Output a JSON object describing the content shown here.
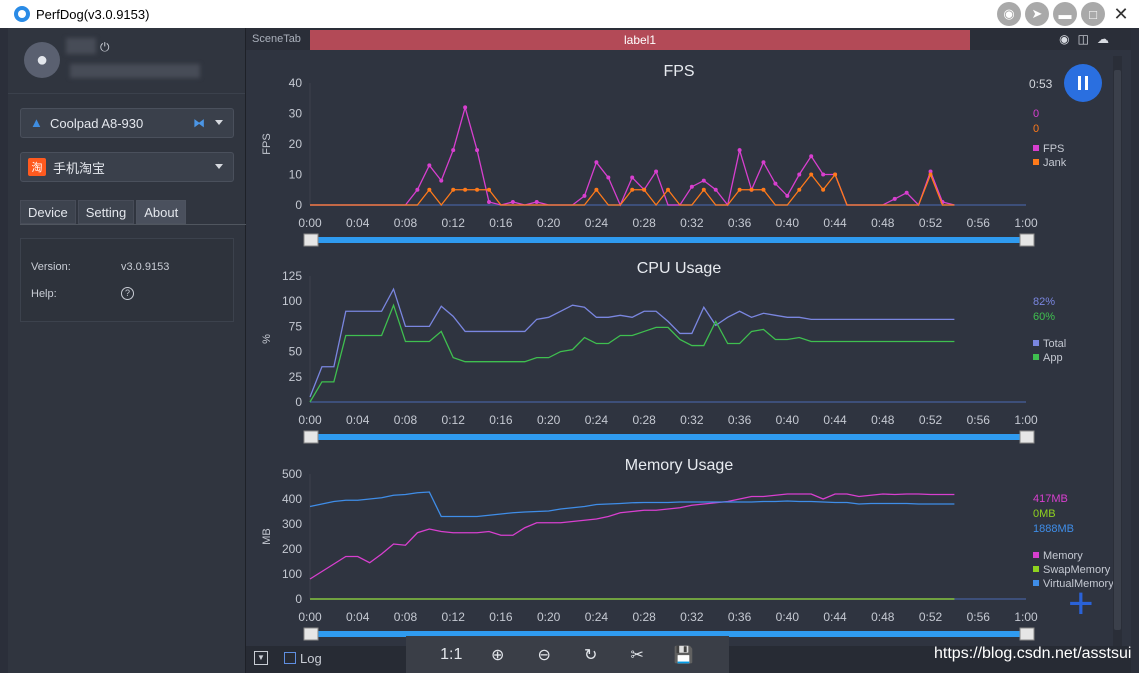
{
  "window": {
    "title": "PerfDog(v3.0.9153)"
  },
  "sidebar": {
    "device": "Coolpad A8-930",
    "app": "手机淘宝",
    "app_icon_text": "淘",
    "tabs": [
      "Device",
      "Setting",
      "About"
    ],
    "about": {
      "version_label": "Version:",
      "version_value": "v3.0.9153",
      "help_label": "Help:"
    }
  },
  "main": {
    "scene_tab": "SceneTab",
    "scene_label": "label1",
    "elapsed": "0:53"
  },
  "bottom": {
    "log_label": "Log",
    "watermark": "https://blog.csdn.net/asstsui"
  },
  "chart_data": [
    {
      "type": "line",
      "title": "FPS",
      "ylabel": "FPS",
      "xlabel": "",
      "ylim": [
        0,
        40
      ],
      "yticks": [
        0,
        10,
        20,
        30,
        40
      ],
      "x_ticks": [
        "0:00",
        "0:04",
        "0:08",
        "0:12",
        "0:16",
        "0:20",
        "0:24",
        "0:28",
        "0:32",
        "0:36",
        "0:40",
        "0:44",
        "0:48",
        "0:52",
        "0:56",
        "1:00"
      ],
      "x_minutes_span": 60,
      "legend": [
        {
          "name": "FPS",
          "color": "#d83fcf",
          "current": "0"
        },
        {
          "name": "Jank",
          "color": "#ff7a1a",
          "current": "0"
        }
      ],
      "series": [
        {
          "name": "FPS",
          "color": "#d83fcf",
          "x": [
            0,
            1,
            2,
            3,
            4,
            5,
            6,
            7,
            8,
            9,
            10,
            11,
            12,
            13,
            14,
            15,
            16,
            17,
            18,
            19,
            20,
            21,
            22,
            23,
            24,
            25,
            26,
            27,
            28,
            29,
            30,
            31,
            32,
            33,
            34,
            35,
            36,
            37,
            38,
            39,
            40,
            41,
            42,
            43,
            44,
            45,
            46,
            47,
            48,
            49,
            50,
            51,
            52,
            53,
            54
          ],
          "values": [
            0,
            0,
            0,
            0,
            0,
            0,
            0,
            0,
            0,
            5,
            13,
            8,
            18,
            32,
            18,
            1,
            0,
            1,
            0,
            1,
            0,
            0,
            0,
            3,
            14,
            9,
            0,
            9,
            5,
            11,
            0,
            0,
            6,
            8,
            5,
            0,
            18,
            5,
            14,
            7,
            3,
            10,
            16,
            10,
            10,
            0,
            0,
            0,
            0,
            2,
            4,
            0,
            11,
            1,
            0
          ]
        },
        {
          "name": "Jank",
          "color": "#ff7a1a",
          "x": [
            0,
            1,
            2,
            3,
            4,
            5,
            6,
            7,
            8,
            9,
            10,
            11,
            12,
            13,
            14,
            15,
            16,
            17,
            18,
            19,
            20,
            21,
            22,
            23,
            24,
            25,
            26,
            27,
            28,
            29,
            30,
            31,
            32,
            33,
            34,
            35,
            36,
            37,
            38,
            39,
            40,
            41,
            42,
            43,
            44,
            45,
            46,
            47,
            48,
            49,
            50,
            51,
            52,
            53,
            54
          ],
          "values": [
            0,
            0,
            0,
            0,
            0,
            0,
            0,
            0,
            0,
            0,
            5,
            0,
            5,
            5,
            5,
            5,
            0,
            0,
            0,
            0,
            0,
            0,
            0,
            0,
            5,
            0,
            0,
            5,
            5,
            0,
            5,
            0,
            0,
            5,
            0,
            0,
            5,
            5,
            5,
            0,
            0,
            5,
            10,
            5,
            10,
            0,
            0,
            0,
            0,
            0,
            0,
            0,
            10,
            0,
            0
          ]
        }
      ]
    },
    {
      "type": "line",
      "title": "CPU Usage",
      "ylabel": "%",
      "xlabel": "",
      "ylim": [
        0,
        125
      ],
      "yticks": [
        0,
        25,
        50,
        75,
        100,
        125
      ],
      "x_ticks": [
        "0:00",
        "0:04",
        "0:08",
        "0:12",
        "0:16",
        "0:20",
        "0:24",
        "0:28",
        "0:32",
        "0:36",
        "0:40",
        "0:44",
        "0:48",
        "0:52",
        "0:56",
        "1:00"
      ],
      "x_minutes_span": 60,
      "legend": [
        {
          "name": "Total",
          "color": "#7a86e0",
          "current": "82%"
        },
        {
          "name": "App",
          "color": "#3fbf4f",
          "current": "60%"
        }
      ],
      "series": [
        {
          "name": "Total",
          "color": "#7a86e0",
          "x": [
            0,
            1,
            2,
            3,
            4,
            5,
            6,
            7,
            8,
            9,
            10,
            11,
            12,
            13,
            14,
            15,
            16,
            17,
            18,
            19,
            20,
            21,
            22,
            23,
            24,
            25,
            26,
            27,
            28,
            29,
            30,
            31,
            32,
            33,
            34,
            35,
            36,
            37,
            38,
            39,
            40,
            41,
            42,
            43,
            44,
            54
          ],
          "values": [
            5,
            35,
            35,
            90,
            90,
            90,
            90,
            112,
            75,
            75,
            75,
            95,
            85,
            70,
            70,
            70,
            70,
            70,
            70,
            82,
            84,
            90,
            96,
            94,
            84,
            84,
            86,
            84,
            90,
            90,
            80,
            68,
            68,
            94,
            76,
            84,
            90,
            84,
            88,
            86,
            84,
            84,
            82,
            82,
            82,
            82
          ]
        },
        {
          "name": "App",
          "color": "#3fbf4f",
          "x": [
            0,
            1,
            2,
            3,
            4,
            5,
            6,
            7,
            8,
            9,
            10,
            11,
            12,
            13,
            14,
            15,
            16,
            17,
            18,
            19,
            20,
            21,
            22,
            23,
            24,
            25,
            26,
            27,
            28,
            29,
            30,
            31,
            32,
            33,
            34,
            35,
            36,
            37,
            38,
            39,
            40,
            41,
            42,
            54
          ],
          "values": [
            0,
            20,
            20,
            66,
            66,
            66,
            66,
            96,
            60,
            60,
            60,
            70,
            44,
            40,
            40,
            40,
            40,
            40,
            40,
            44,
            44,
            50,
            52,
            64,
            58,
            58,
            66,
            66,
            70,
            74,
            74,
            62,
            56,
            56,
            80,
            58,
            58,
            70,
            72,
            62,
            62,
            64,
            60,
            60
          ]
        }
      ]
    },
    {
      "type": "line",
      "title": "Memory Usage",
      "ylabel": "MB",
      "xlabel": "",
      "ylim": [
        0,
        500
      ],
      "yticks": [
        0,
        100,
        200,
        300,
        400,
        500
      ],
      "x_ticks": [
        "0:00",
        "0:04",
        "0:08",
        "0:12",
        "0:16",
        "0:20",
        "0:24",
        "0:28",
        "0:32",
        "0:36",
        "0:40",
        "0:44",
        "0:48",
        "0:52",
        "0:56",
        "1:00"
      ],
      "x_minutes_span": 60,
      "legend": [
        {
          "name": "Memory",
          "color": "#d83fcf",
          "current": "417MB"
        },
        {
          "name": "SwapMemory",
          "color": "#8fd21f",
          "current": "0MB"
        },
        {
          "name": "VirtualMemory",
          "color": "#3f8de8",
          "current": "1888MB"
        }
      ],
      "series": [
        {
          "name": "Memory",
          "color": "#d83fcf",
          "x": [
            0,
            1,
            2,
            3,
            4,
            5,
            6,
            7,
            8,
            9,
            10,
            11,
            12,
            13,
            14,
            15,
            16,
            17,
            18,
            19,
            20,
            21,
            22,
            23,
            24,
            25,
            26,
            27,
            28,
            29,
            30,
            31,
            32,
            33,
            34,
            35,
            36,
            37,
            38,
            39,
            40,
            41,
            42,
            43,
            44,
            45,
            46,
            47,
            48,
            49,
            50,
            51,
            52,
            53,
            54
          ],
          "values": [
            80,
            110,
            140,
            170,
            170,
            145,
            180,
            220,
            215,
            265,
            280,
            270,
            265,
            265,
            265,
            270,
            255,
            255,
            285,
            305,
            305,
            305,
            310,
            315,
            320,
            330,
            345,
            350,
            355,
            355,
            360,
            365,
            375,
            380,
            385,
            390,
            400,
            410,
            410,
            415,
            420,
            420,
            420,
            400,
            420,
            420,
            410,
            415,
            420,
            418,
            420,
            420,
            418,
            418,
            418
          ]
        },
        {
          "name": "SwapMemory",
          "color": "#8fd21f",
          "x": [
            0,
            54
          ],
          "values": [
            0,
            0
          ]
        },
        {
          "name": "VirtualMemory",
          "color": "#3f8de8",
          "x": [
            0,
            1,
            2,
            3,
            4,
            5,
            6,
            7,
            8,
            9,
            10,
            11,
            12,
            13,
            14,
            15,
            16,
            17,
            18,
            19,
            20,
            21,
            22,
            23,
            24,
            25,
            26,
            27,
            28,
            29,
            30,
            31,
            32,
            33,
            34,
            35,
            36,
            37,
            38,
            39,
            40,
            41,
            42,
            43,
            44,
            45,
            46,
            47,
            48,
            49,
            50,
            51,
            52,
            53,
            54
          ],
          "values": [
            370,
            380,
            390,
            395,
            395,
            400,
            405,
            415,
            418,
            425,
            428,
            330,
            330,
            330,
            330,
            335,
            340,
            345,
            348,
            350,
            352,
            360,
            365,
            370,
            378,
            380,
            382,
            385,
            386,
            386,
            386,
            388,
            388,
            388,
            388,
            388,
            388,
            388,
            390,
            390,
            392,
            390,
            390,
            388,
            386,
            386,
            380,
            382,
            382,
            382,
            382,
            380,
            380,
            380,
            380
          ]
        }
      ]
    }
  ]
}
